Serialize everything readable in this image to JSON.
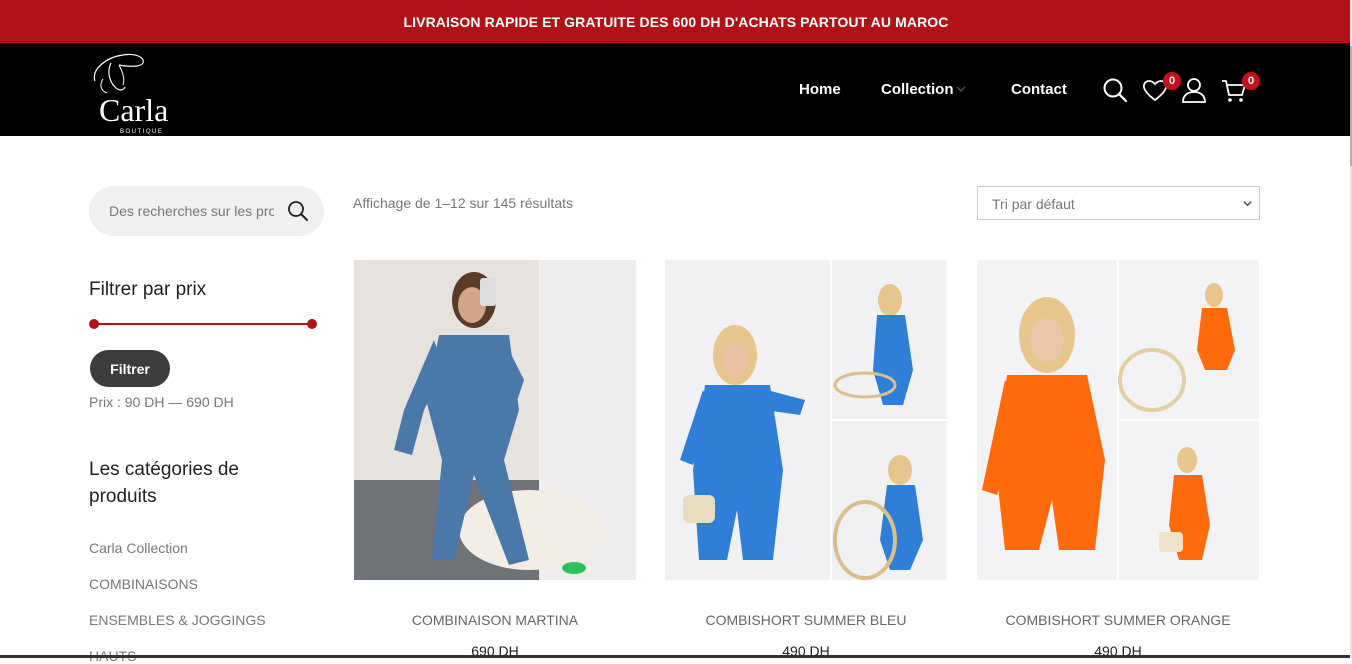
{
  "promo": {
    "text": "LIVRAISON RAPIDE ET GRATUITE DES 600 DH D'ACHATS PARTOUT AU MAROC"
  },
  "header": {
    "logo_text": "Carla",
    "logo_subtext": "BOUTIQUE",
    "nav": {
      "home": "Home",
      "collection": "Collection",
      "contact": "Contact"
    },
    "wishlist_count": "0",
    "cart_count": "0"
  },
  "sidebar": {
    "search_placeholder": "Des recherches sur les produits",
    "filter_title": "Filtrer par prix",
    "filter_button": "Filtrer",
    "price_range": "Prix : 90 DH — 690 DH",
    "categories_title": "Les catégories de produits",
    "categories": [
      "Carla Collection",
      "COMBINAISONS",
      "ENSEMBLES & JOGGINGS",
      "HAUTS"
    ]
  },
  "shop": {
    "result_count": "Affichage de 1–12 sur 145 résultats",
    "sort_selected": "Tri par défaut",
    "products": [
      {
        "name": "COMBINAISON MARTINA",
        "price": "690 DH"
      },
      {
        "name": "COMBISHORT SUMMER BLEU",
        "price": "490 DH"
      },
      {
        "name": "COMBISHORT SUMMER ORANGE",
        "price": "490 DH"
      }
    ]
  },
  "colors": {
    "brand_red": "#b01217",
    "header_bg": "#000000",
    "button_dark": "#3c3c3c"
  }
}
